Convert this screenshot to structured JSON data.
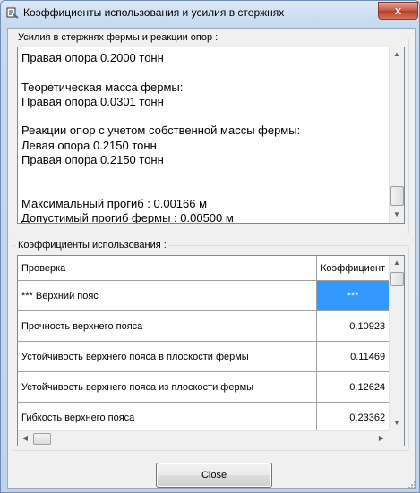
{
  "window": {
    "title": "Коэффициенты использования и усилия в стержнях",
    "close_glyph": "x"
  },
  "forces_group": {
    "title": "Усилия в стержнях фермы и реакции опор :",
    "text": "Правая опора 0.2000 тонн\n\nТеоретическая масса фермы:\nПравая опора 0.0301 тонн\n\nРеакции опор с учетом собственной массы фермы:\nЛевая опора 0.2150 тонн\nПравая опора 0.2150 тонн\n\n\nМаксимальный прогиб : 0.00166 м\nДопустимый прогиб фермы : 0.00500 м"
  },
  "coef_group": {
    "title": "Коэффициенты использования :",
    "columns": [
      "Проверка",
      "Коэффициент"
    ],
    "rows": [
      {
        "check": "*** Верхний пояс",
        "value": "***"
      },
      {
        "check": "Прочность верхнего пояса",
        "value": "0.10923"
      },
      {
        "check": "Устойчивость верхнего пояса в плоскости фермы",
        "value": "0.11469"
      },
      {
        "check": "Устойчивость верхнего пояса из плоскости фермы",
        "value": "0.12624"
      },
      {
        "check": "Гибкость верхнего пояса",
        "value": "0.23362"
      }
    ]
  },
  "buttons": {
    "close_label": "Close"
  },
  "colors": {
    "selection": "#3399ff",
    "title_close": "#c7513a"
  }
}
